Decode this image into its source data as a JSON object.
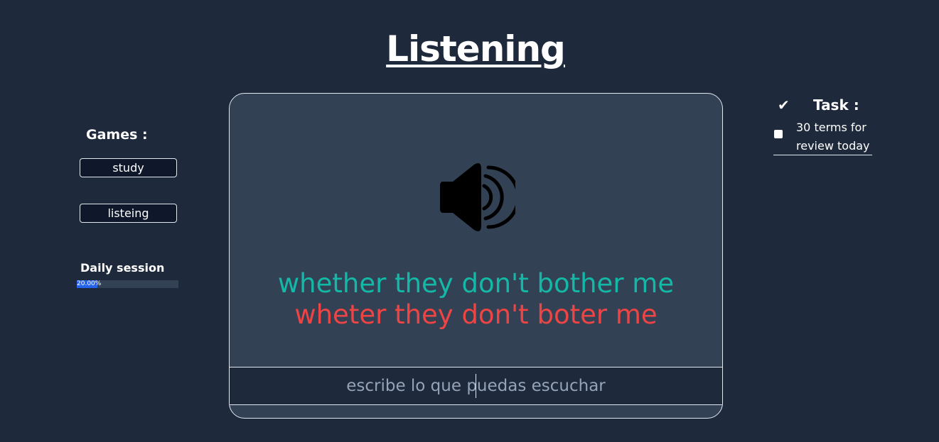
{
  "page": {
    "title": "Listening"
  },
  "sidebar": {
    "games_heading": "Games :",
    "buttons": [
      {
        "label": "study"
      },
      {
        "label": "listeing"
      }
    ],
    "daily_session": {
      "label": "Daily session",
      "progress_text": "20.00%",
      "progress_fraction": 0.2
    }
  },
  "card": {
    "speaker_icon": "speaker-volume-icon",
    "correct_answer": "whether they don't bother me",
    "user_answer": "wheter they don't boter me",
    "input": {
      "value": "",
      "placeholder": "escribe lo que puedas escuchar"
    }
  },
  "tasks": {
    "check_icon": "checkmark-icon",
    "heading": "Task :",
    "items": [
      {
        "label": "30 terms for review today",
        "checked": false
      }
    ]
  },
  "colors": {
    "background": "#1e293b",
    "card": "#334155",
    "correct": "#14b8a6",
    "incorrect": "#ef4444",
    "progress": "#2563eb"
  }
}
